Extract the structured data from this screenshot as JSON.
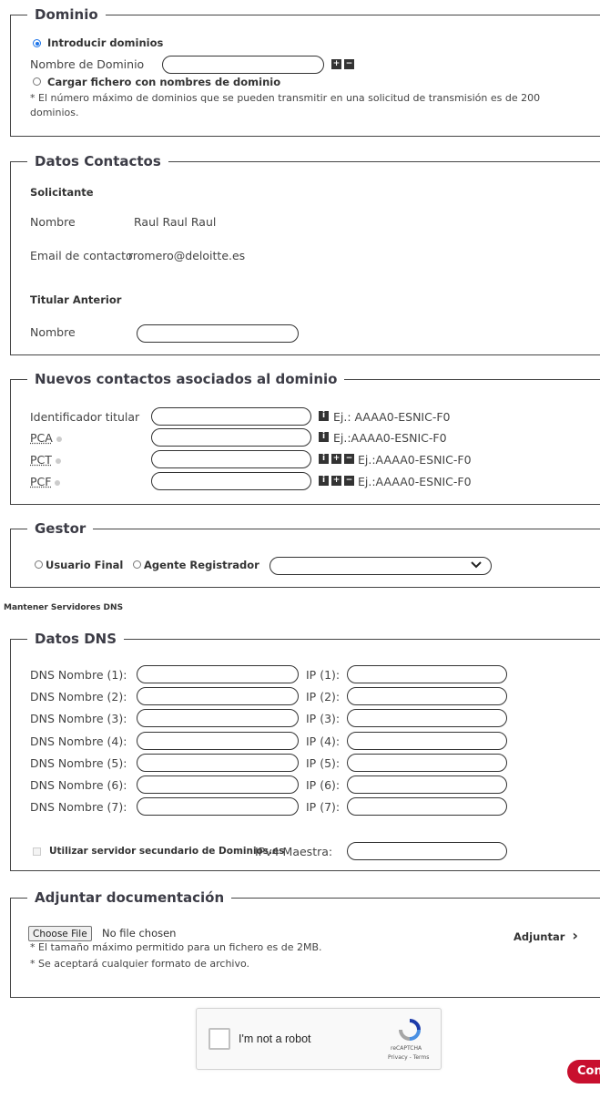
{
  "dominio": {
    "legend": "Dominio",
    "radio_manual": "Introducir dominios",
    "name_label": "Nombre de Dominio",
    "add_icon": "plus-icon",
    "remove_icon": "minus-icon",
    "radio_file": "Cargar fichero con nombres de dominio",
    "note": "* El número máximo de dominios que se pueden transmitir en una solicitud de transmisión es de 200",
    "note2": "dominios."
  },
  "contactos": {
    "legend": "Datos Contactos",
    "solicitante_heading": "Solicitante",
    "nombre_label": "Nombre",
    "nombre_value": "Raul Raul Raul",
    "email_label": "Email de contacto",
    "email_value": "rromero@deloitte.es",
    "titular_heading": "Titular Anterior",
    "titular_nombre_label": "Nombre"
  },
  "nuevos": {
    "legend": "Nuevos contactos asociados al dominio",
    "rows": [
      {
        "label": "Identificador titular",
        "hint": "Ej.: AAAA0-ESNIC-F0"
      },
      {
        "label": "PCA",
        "hint": "Ej.:AAAA0-ESNIC-F0"
      },
      {
        "label": "PCT",
        "hint": "Ej.:AAAA0-ESNIC-F0"
      },
      {
        "label": "PCF",
        "hint": "Ej.:AAAA0-ESNIC-F0"
      }
    ]
  },
  "gestor": {
    "legend": "Gestor",
    "option_final": "Usuario Final",
    "option_agente": "Agente Registrador",
    "select_value": ""
  },
  "mantener_label": "Mantener Servidores DNS",
  "dns": {
    "legend": "Datos DNS",
    "rows": [
      {
        "name_label": "DNS Nombre (1):",
        "ip_label": "IP (1):"
      },
      {
        "name_label": "DNS Nombre (2):",
        "ip_label": "IP (2):"
      },
      {
        "name_label": "DNS Nombre (3):",
        "ip_label": "IP (3):"
      },
      {
        "name_label": "DNS Nombre (4):",
        "ip_label": "IP (4):"
      },
      {
        "name_label": "DNS Nombre (5):",
        "ip_label": "IP (5):"
      },
      {
        "name_label": "DNS Nombre (6):",
        "ip_label": "IP (6):"
      },
      {
        "name_label": "DNS Nombre (7):",
        "ip_label": "IP (7):"
      }
    ],
    "secondary_label": "Utilizar servidor secundario de Dominios.es",
    "ipv4_label": "IPv4 Maestra:"
  },
  "adjuntar": {
    "legend": "Adjuntar documentación",
    "choose_button": "Choose File",
    "no_file": "No file chosen",
    "note1": "* El tamaño máximo permitido para un fichero es de 2MB.",
    "note2": "* Se aceptará cualquier formato de archivo.",
    "attach_link": "Adjuntar",
    "attach_chevron": "›"
  },
  "captcha": {
    "label": "I'm not a robot",
    "brand": "reCAPTCHA",
    "privacy": "Privacy",
    "sep": " - ",
    "terms": "Terms"
  },
  "continue_button": "Con",
  "colors": {
    "accent": "#1a73e8",
    "submit": "#c8102e",
    "border": "#444444"
  }
}
